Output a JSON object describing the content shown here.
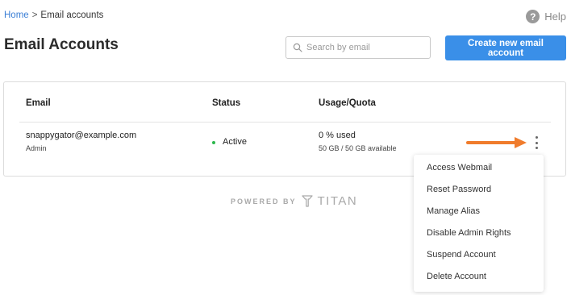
{
  "breadcrumb": {
    "home": "Home",
    "separator": ">",
    "current": "Email accounts"
  },
  "help": {
    "label": "Help",
    "icon": "help-circle-icon",
    "glyph": "?"
  },
  "page": {
    "title": "Email Accounts"
  },
  "search": {
    "placeholder": "Search by email",
    "value": "",
    "icon": "search-icon"
  },
  "create_button": {
    "label": "Create new email account",
    "color": "#3a8fe8"
  },
  "table": {
    "headers": {
      "email": "Email",
      "status": "Status",
      "usage": "Usage/Quota"
    },
    "rows": [
      {
        "email": "snappygator@example.com",
        "role": "Admin",
        "status": "Active",
        "status_color": "#2db84d",
        "usage": "0 % used",
        "quota": "50 GB / 50 GB available",
        "menu_icon": "kebab-menu-icon"
      }
    ]
  },
  "powered_by": {
    "label": "POWERED BY",
    "brand": "TITAN",
    "logo_icon": "titan-logo-icon"
  },
  "menu": {
    "items": [
      "Access Webmail",
      "Reset Password",
      "Manage Alias",
      "Disable Admin Rights",
      "Suspend Account",
      "Delete Account"
    ]
  },
  "annotation": {
    "icon": "arrow-right-icon",
    "color": "#f07c2c"
  }
}
